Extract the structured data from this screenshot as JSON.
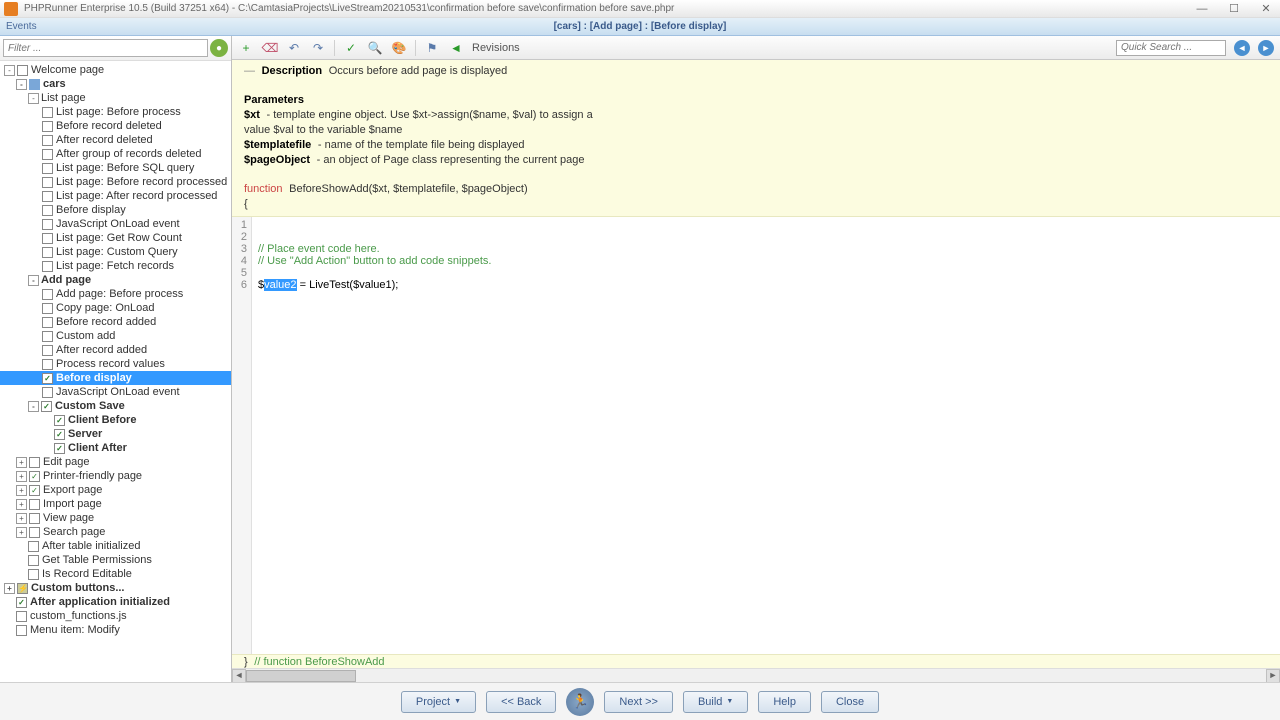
{
  "window": {
    "title": "PHPRunner Enterprise 10.5 (Build 37251 x64) - C:\\CamtasiaProjects\\LiveStream20210531\\confirmation before save\\confirmation before save.phpr"
  },
  "menu": {
    "events_label": "Events",
    "breadcrumb": "[cars]  :  [Add page]  :  [Before display]"
  },
  "sidebar": {
    "filter_placeholder": "Filter ...",
    "nodes": {
      "welcome": "Welcome page",
      "cars": "cars",
      "list_page": "List page",
      "list_before_process": "List page: Before process",
      "before_record_deleted": "Before record deleted",
      "after_record_deleted": "After record deleted",
      "after_group_deleted": "After group of records deleted",
      "list_before_sql": "List page: Before SQL query",
      "list_before_rec_processed": "List page: Before record processed",
      "list_after_rec_processed": "List page: After record processed",
      "before_display_list": "Before display",
      "js_onload_list": "JavaScript OnLoad event",
      "get_row_count": "List page: Get Row Count",
      "custom_query": "List page: Custom Query",
      "fetch_records": "List page: Fetch records",
      "add_page": "Add page",
      "add_before_process": "Add page: Before process",
      "copy_onload": "Copy page: OnLoad",
      "before_record_added": "Before record added",
      "custom_add": "Custom add",
      "after_record_added": "After record added",
      "process_record_values": "Process record values",
      "before_display_add": "Before display",
      "js_onload_add": "JavaScript OnLoad event",
      "custom_save": "Custom Save",
      "client_before": "Client Before",
      "server": "Server",
      "client_after": "Client After",
      "edit_page": "Edit page",
      "printer_page": "Printer-friendly page",
      "export_page": "Export page",
      "import_page": "Import page",
      "view_page": "View page",
      "search_page": "Search page",
      "after_table_init": "After table initialized",
      "get_table_perms": "Get Table Permissions",
      "is_record_editable": "Is Record Editable",
      "custom_buttons": "Custom buttons...",
      "after_app_init": "After application initialized",
      "custom_functions": "custom_functions.js",
      "menu_modify": "Menu item: Modify"
    }
  },
  "toolbar": {
    "revisions": "Revisions",
    "quick_search": "Quick Search ..."
  },
  "header": {
    "desc_label": "Description",
    "desc_text": "Occurs before add page is displayed",
    "params_label": "Parameters",
    "p1a": "$xt",
    "p1b": "- template engine object. Use $xt->assign($name, $val) to assign a",
    "p1c": "value $val to the variable $name",
    "p2a": "$templatefile",
    "p2b": "- name of the template file being displayed",
    "p3a": "$pageObject",
    "p3b": "- an object of Page class representing the current page",
    "fn_kw": "function",
    "fn_name": "BeforeShowAdd",
    "fn_args": "($xt, $templatefile, $pageObject)",
    "brace": "{"
  },
  "code": {
    "l3": "// Place event code here.",
    "l4": "// Use \"Add Action\" button to add code snippets.",
    "l6_pre": "$",
    "l6_sel": "value2",
    "l6_post": " = LiveTest($value1);"
  },
  "footer": {
    "text": "}  // function BeforeShowAdd"
  },
  "bottom": {
    "project": "Project",
    "back": "<< Back",
    "next": "Next >>",
    "build": "Build",
    "help": "Help",
    "close": "Close"
  }
}
